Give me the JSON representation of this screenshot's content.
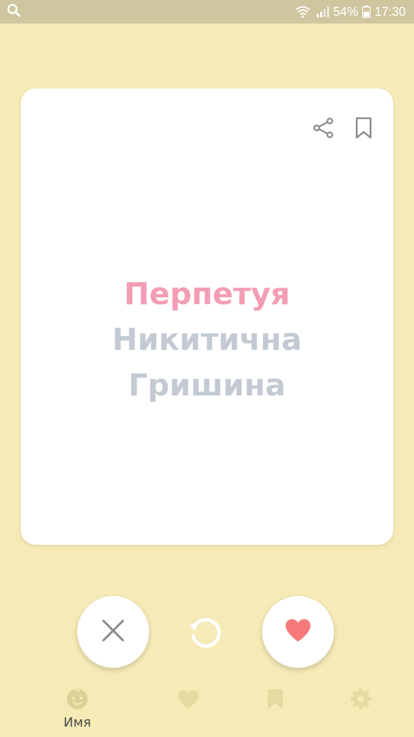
{
  "status_bar": {
    "battery": "54%",
    "time": "17:30"
  },
  "card": {
    "first_name": "Перпетуя",
    "patronymic": "Никитична",
    "surname": "Гришина",
    "icons": [
      "share-icon",
      "bookmark-icon"
    ]
  },
  "actions": {
    "icons": [
      "close-icon",
      "undo-icon",
      "heart-icon"
    ]
  },
  "bottom_nav": {
    "items": [
      {
        "label": "Имя",
        "icon": "baby-face-icon",
        "active": true
      },
      {
        "label": "",
        "icon": "heart-icon",
        "active": false
      },
      {
        "label": "",
        "icon": "bookmark-icon",
        "active": false
      },
      {
        "label": "",
        "icon": "gear-icon",
        "active": false
      }
    ]
  },
  "colors": {
    "background": "#F6EBB6",
    "status_bar": "#CFC6A0",
    "first_name": "#F39DB5",
    "secondary_name": "#C3CAD3",
    "like": "#F77A7A",
    "nav_inactive": "#E6DAA3",
    "nav_active": "#DDD196"
  }
}
